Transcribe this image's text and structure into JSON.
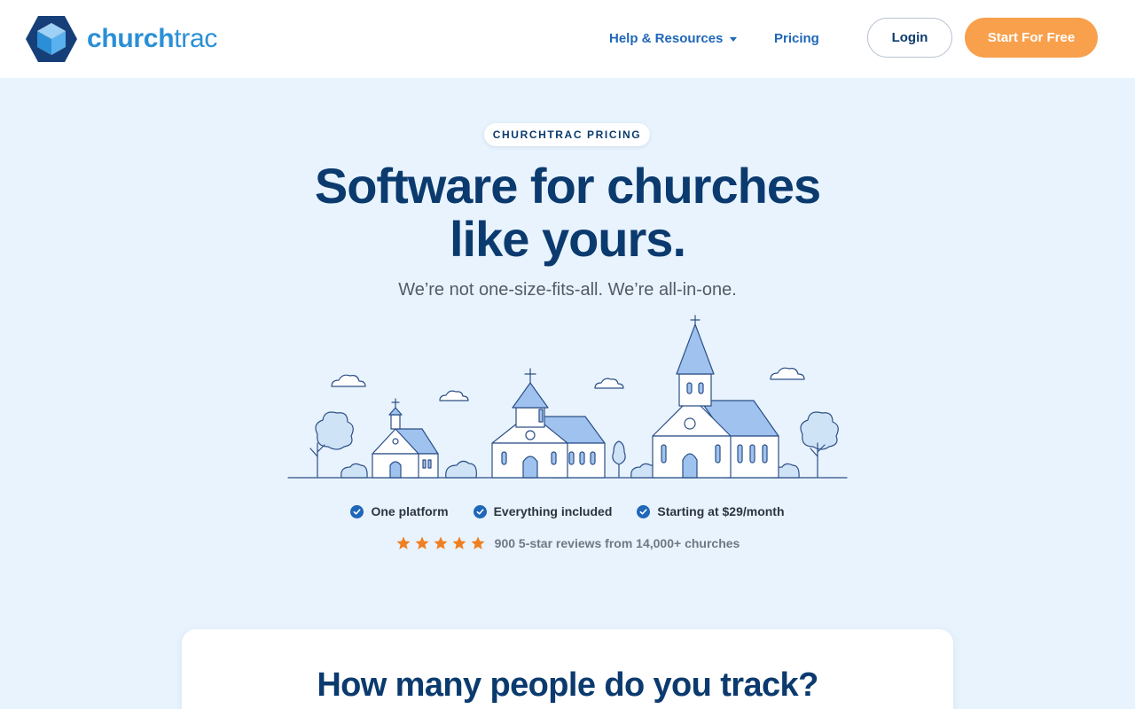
{
  "brand": {
    "name_bold": "church",
    "name_light": "trac"
  },
  "nav": {
    "help_label": "Help & Resources",
    "pricing_label": "Pricing",
    "login_label": "Login",
    "start_label": "Start For Free"
  },
  "hero": {
    "eyebrow": "CHURCHTRAC PRICING",
    "title_line1": "Software for churches",
    "title_line2": "like yours.",
    "subtitle": "We’re not one-size-fits-all. We’re all-in-one."
  },
  "features": [
    {
      "label": "One platform"
    },
    {
      "label": "Everything included"
    },
    {
      "label": "Starting at $29/month"
    }
  ],
  "rating": {
    "stars": 5,
    "text": "900 5-star reviews from 14,000+ churches"
  },
  "section": {
    "title": "How many people do you track?"
  },
  "colors": {
    "primary": "#0b3a6e",
    "link": "#1f67b8",
    "accent_orange": "#f9a04c",
    "star_orange": "#f07f22",
    "hero_bg": "#e8f3fd"
  },
  "icons": [
    "chevron-down-icon",
    "check-circle-icon",
    "star-icon",
    "churchtrac-logo-icon"
  ]
}
